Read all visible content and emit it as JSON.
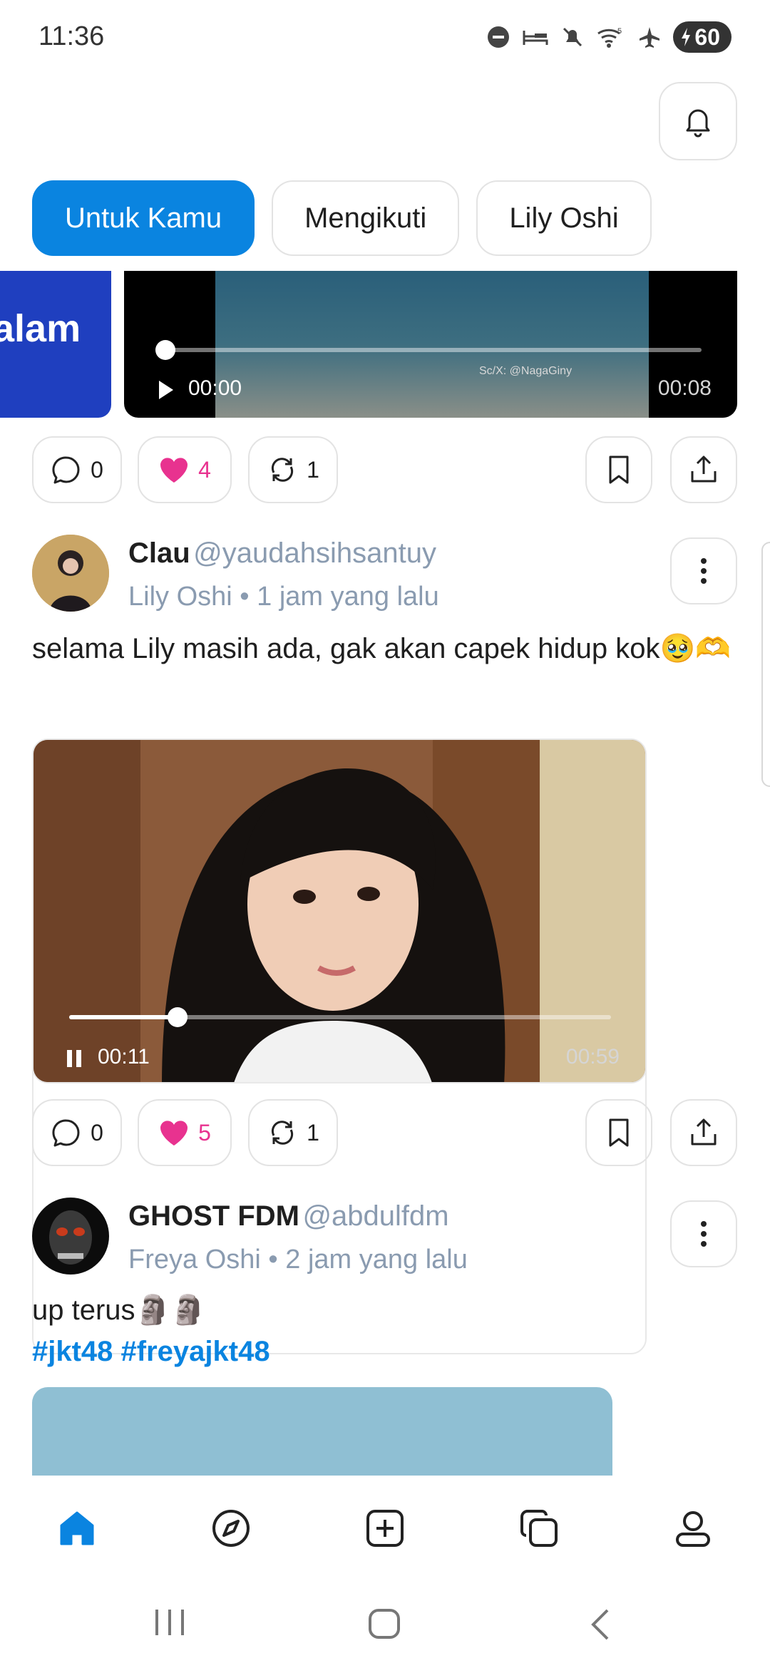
{
  "status_bar": {
    "time": "11:36",
    "battery": "60",
    "icons": [
      "dnd-icon",
      "sleep-icon",
      "mute-icon",
      "wifi-icon",
      "airplane-icon",
      "battery-charging-icon"
    ]
  },
  "header": {
    "bell_icon": "bell-icon"
  },
  "tabs": [
    {
      "label": "Untuk Kamu",
      "active": true
    },
    {
      "label": "Mengikuti",
      "active": false
    },
    {
      "label": "Lily Oshi",
      "active": false
    }
  ],
  "previous_post": {
    "thumb_text": "alam",
    "video": {
      "current": "00:00",
      "duration": "00:08",
      "watermark": "Sc/X: @NagaGiny",
      "progress": 0
    },
    "comments": "0",
    "likes": "4",
    "reposts": "1"
  },
  "posts": [
    {
      "author": "Clau",
      "handle": "@yaudahsihsantuy",
      "group": "Lily Oshi",
      "time": "1 jam yang lalu",
      "text": "selama Lily masih ada, gak akan capek hidup kok🥹🫶",
      "video": {
        "current": "00:11",
        "duration": "00:59",
        "progress": 0.19
      },
      "comments": "0",
      "likes": "5",
      "reposts": "1"
    },
    {
      "author": "GHOST FDM",
      "handle": "@abdulfdm",
      "group": "Freya Oshi",
      "time": "2 jam yang lalu",
      "text": "up terus🗿🗿",
      "tags": "#jkt48 #freyajkt48"
    }
  ],
  "separator": "•",
  "bottom_nav": [
    "home-icon",
    "explore-icon",
    "create-icon",
    "collections-icon",
    "profile-icon"
  ],
  "colors": {
    "accent": "#0a84e0",
    "like": "#e8328f",
    "muted": "#8a9bb0"
  }
}
